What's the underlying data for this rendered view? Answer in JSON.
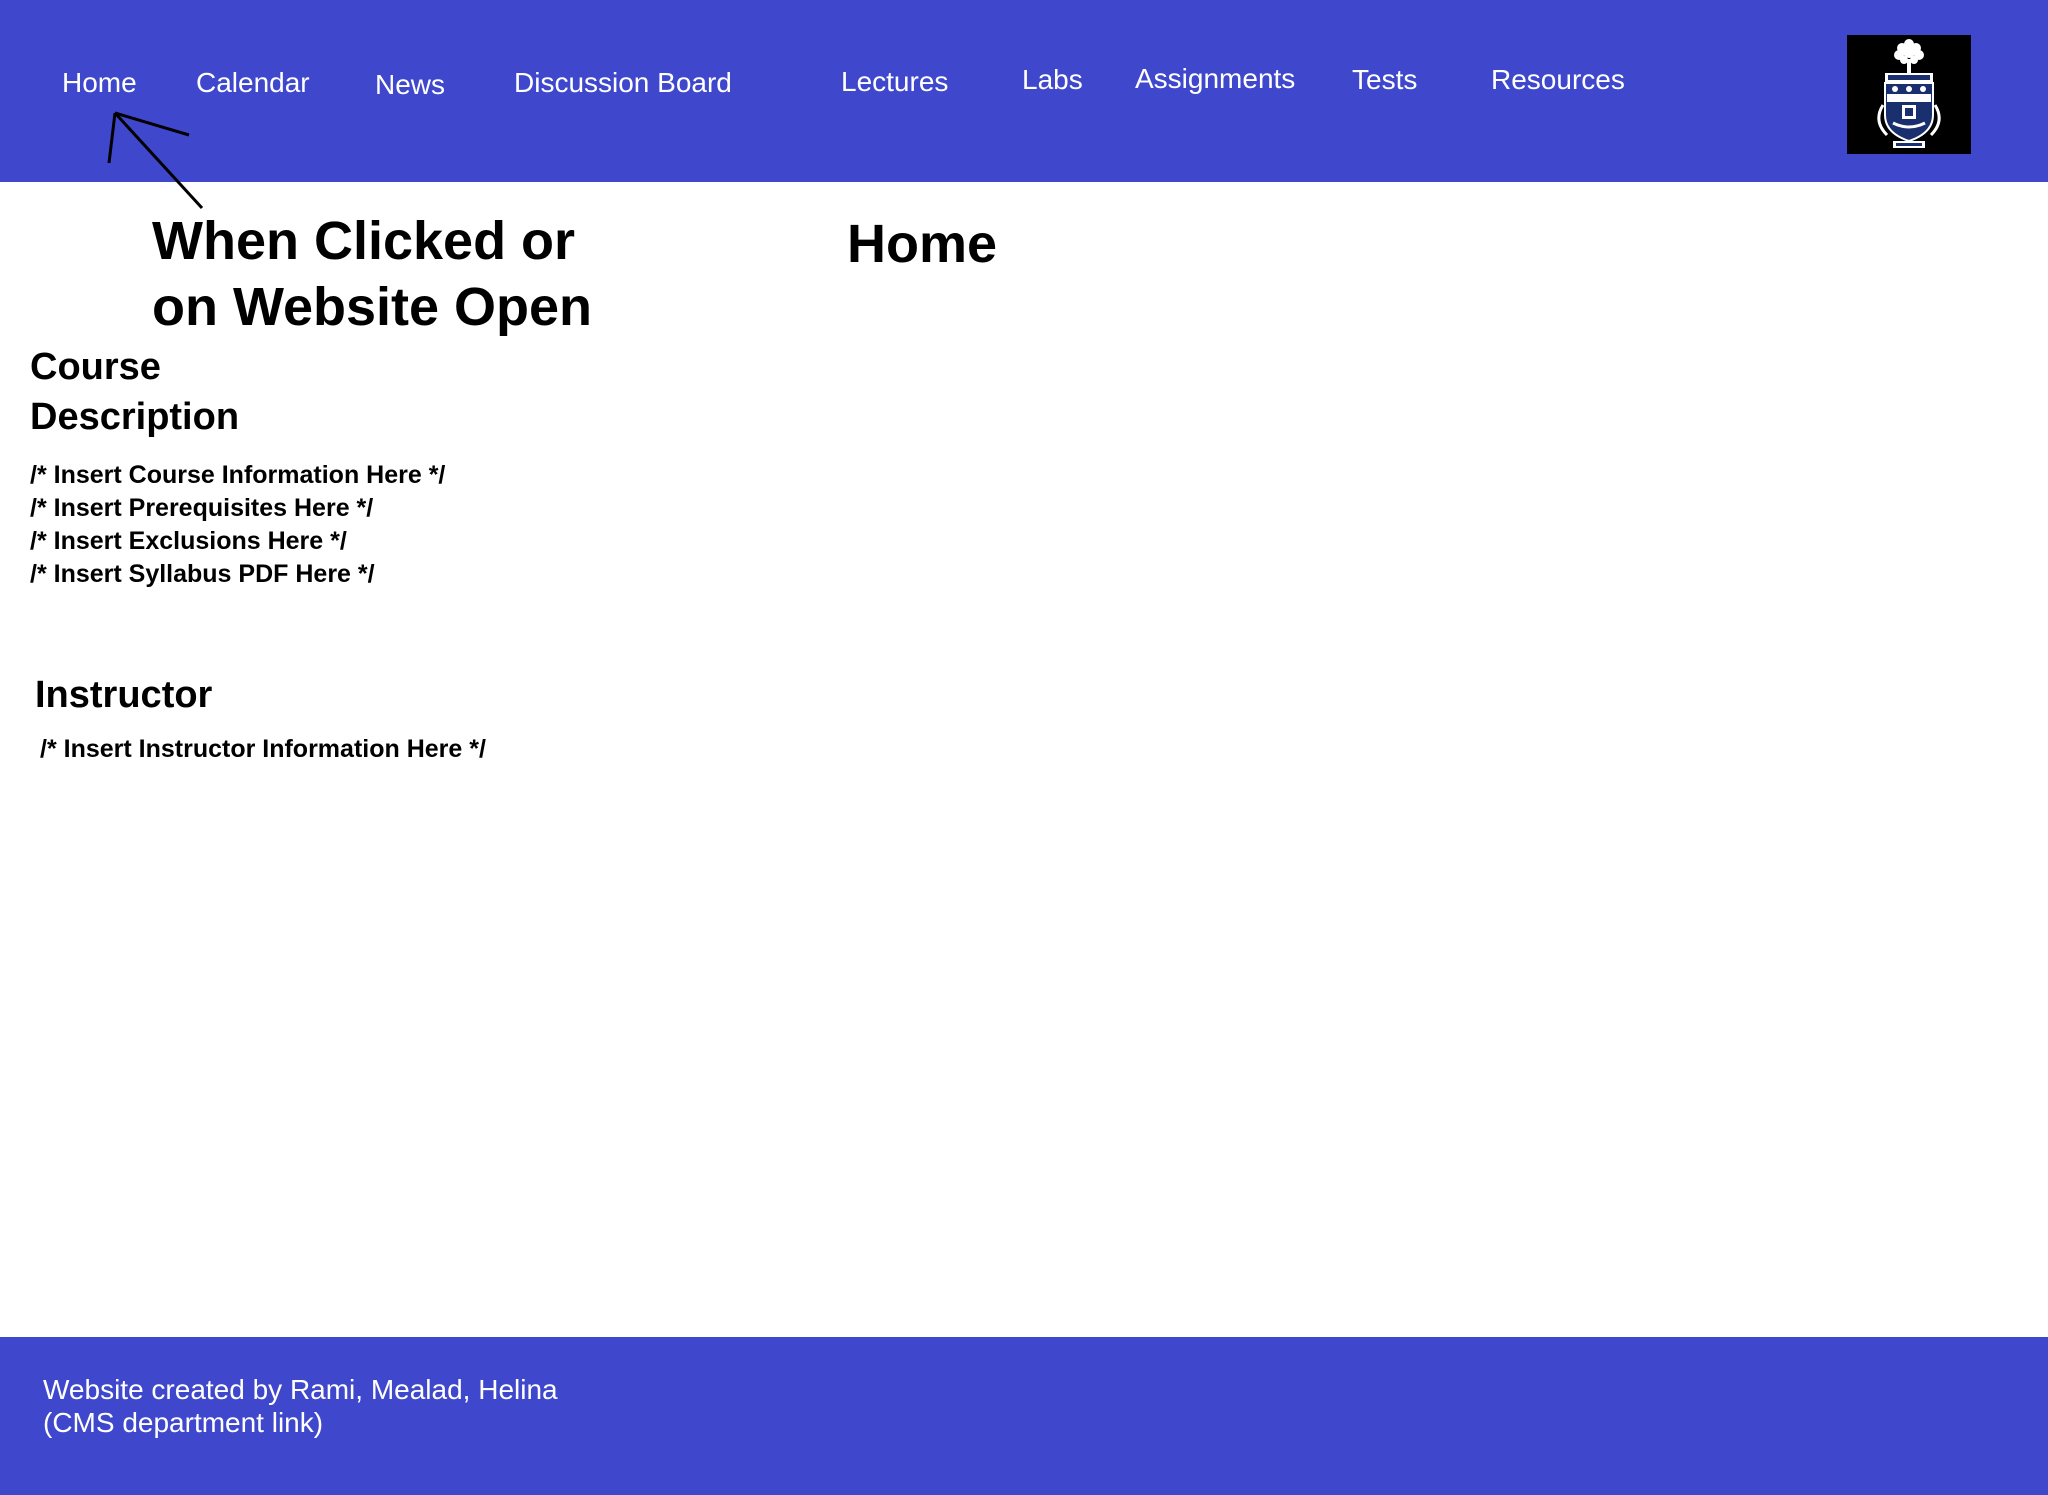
{
  "colors": {
    "header_bg": "#3f48cc",
    "footer_bg": "#3f48cc",
    "nav_text": "#ffffff",
    "body_text": "#000000",
    "page_bg": "#ffffff"
  },
  "nav": {
    "items": [
      {
        "label": "Home"
      },
      {
        "label": "Calendar"
      },
      {
        "label": "News"
      },
      {
        "label": "Discussion Board"
      },
      {
        "label": "Lectures"
      },
      {
        "label": "Labs"
      },
      {
        "label": "Assignments"
      },
      {
        "label": "Tests"
      },
      {
        "label": "Resources"
      }
    ]
  },
  "logo": {
    "icon": "university-crest-icon"
  },
  "annotation": {
    "text": "When Clicked or\non Website Open",
    "icon": "arrow-icon"
  },
  "main": {
    "title": "Home",
    "course": {
      "heading": "Course\nDescription",
      "lines": [
        "/* Insert Course Information Here */",
        "/* Insert Prerequisites Here */",
        "/* Insert Exclusions Here */",
        "/* Insert Syllabus PDF Here */"
      ]
    },
    "instructor": {
      "heading": "Instructor",
      "info": "/* Insert Instructor Information Here */"
    }
  },
  "footer": {
    "credit": "Website created by Rami, Mealad, Helina",
    "link": "(CMS department link)"
  }
}
